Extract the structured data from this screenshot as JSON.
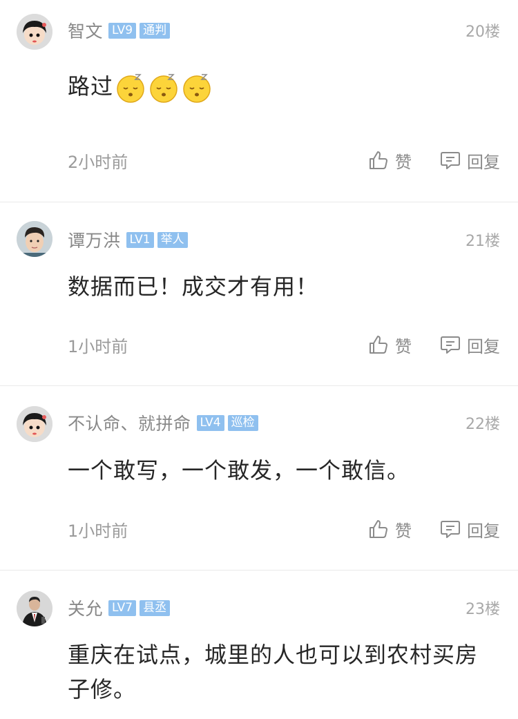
{
  "comments": [
    {
      "username": "智文",
      "level": "LV9",
      "title": "通判",
      "floor": "20楼",
      "content": "路过",
      "emojis": [
        "sleepy-emoji",
        "sleepy-emoji",
        "sleepy-emoji"
      ],
      "time": "2小时前",
      "like_label": "赞",
      "reply_label": "回复"
    },
    {
      "username": "谭万洪",
      "level": "LV1",
      "title": "举人",
      "floor": "21楼",
      "content": "数据而已！成交才有用！",
      "time": "1小时前",
      "like_label": "赞",
      "reply_label": "回复"
    },
    {
      "username": "不认命、就拼命",
      "level": "LV4",
      "title": "巡检",
      "floor": "22楼",
      "content": "一个敢写，一个敢发，一个敢信。",
      "time": "1小时前",
      "like_label": "赞",
      "reply_label": "回复"
    },
    {
      "username": "关允",
      "level": "LV7",
      "title": "县丞",
      "floor": "23楼",
      "content": "重庆在试点，城里的人也可以到农村买房子修。"
    }
  ],
  "colors": {
    "badge": "#8fc0ef",
    "username": "#888888",
    "content": "#262626",
    "meta": "#9a9a9a",
    "divider": "#e9e9e9"
  },
  "icons": {
    "like": "thumbs-up-icon",
    "reply": "comment-bubble-icon"
  }
}
